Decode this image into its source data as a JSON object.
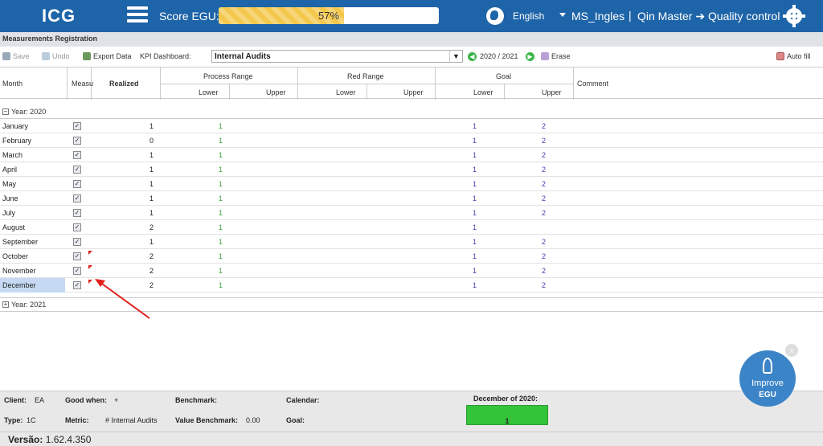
{
  "header": {
    "logo": "ICG",
    "score_label": "Score EGU:",
    "score_value": "57%",
    "score_fraction": 0.57,
    "language": "English",
    "user": "MS_Ingles",
    "separator": "|",
    "breadcrumb": "Qin Master ➔ Quality control"
  },
  "section_title": "Measurements Registration",
  "toolbar": {
    "save": "Save",
    "undo": "Undo",
    "export": "Export Data",
    "kpi_label": "KPI Dashboard:",
    "kpi_value": "Internal Audits",
    "period": "2020 / 2021",
    "erase": "Erase",
    "autofill": "Auto fill"
  },
  "columns": {
    "month": "Month",
    "measured": "Measu",
    "realized": "Realized",
    "process_range": "Process Range",
    "red_range": "Red Range",
    "goal": "Goal",
    "comment": "Comment",
    "lower": "Lower",
    "upper": "Upper"
  },
  "groups": {
    "year2020": "Year: 2020",
    "year2021": "Year: 2021"
  },
  "rows": [
    {
      "month": "January",
      "realized": "1",
      "pr_lower": "1",
      "goal_lower": "1",
      "goal_upper": "2"
    },
    {
      "month": "February",
      "realized": "0",
      "pr_lower": "1",
      "goal_lower": "1",
      "goal_upper": "2"
    },
    {
      "month": "March",
      "realized": "1",
      "pr_lower": "1",
      "goal_lower": "1",
      "goal_upper": "2"
    },
    {
      "month": "April",
      "realized": "1",
      "pr_lower": "1",
      "goal_lower": "1",
      "goal_upper": "2"
    },
    {
      "month": "May",
      "realized": "1",
      "pr_lower": "1",
      "goal_lower": "1",
      "goal_upper": "2"
    },
    {
      "month": "June",
      "realized": "1",
      "pr_lower": "1",
      "goal_lower": "1",
      "goal_upper": "2"
    },
    {
      "month": "July",
      "realized": "1",
      "pr_lower": "1",
      "goal_lower": "1",
      "goal_upper": "2"
    },
    {
      "month": "August",
      "realized": "2",
      "pr_lower": "1",
      "goal_lower": "1",
      "goal_upper": ""
    },
    {
      "month": "September",
      "realized": "1",
      "pr_lower": "1",
      "goal_lower": "1",
      "goal_upper": "2"
    },
    {
      "month": "October",
      "realized": "2",
      "pr_lower": "1",
      "goal_lower": "1",
      "goal_upper": "2"
    },
    {
      "month": "November",
      "realized": "2",
      "pr_lower": "1",
      "goal_lower": "1",
      "goal_upper": "2"
    },
    {
      "month": "December",
      "realized": "2",
      "pr_lower": "1",
      "goal_lower": "1",
      "goal_upper": "2"
    }
  ],
  "footer": {
    "client_label": "Client:",
    "client_value": "EA",
    "good_when_label": "Good when:",
    "good_when_value": "+",
    "benchmark_label": "Benchmark:",
    "calendar_label": "Calendar:",
    "type_label": "Type:",
    "type_value": "1C",
    "metric_label": "Metric:",
    "metric_value": "# Internal Audits",
    "value_benchmark_label": "Value Benchmark:",
    "value_benchmark_value": "0.00",
    "goal_label": "Goal:",
    "dec_label": "December of 2020:",
    "dec_value": "1"
  },
  "version_label": "Versão:",
  "version_value": "1.62.4.350",
  "improve": {
    "line1": "Improve",
    "line2": "EGU",
    "close": "x"
  },
  "colors": {
    "brand": "#1e64a8",
    "score": "#f4c84c",
    "status_green": "#34c43a",
    "range_green": "#3aa33a",
    "goal_blue": "#4040b0",
    "flag_red": "#e02020"
  }
}
